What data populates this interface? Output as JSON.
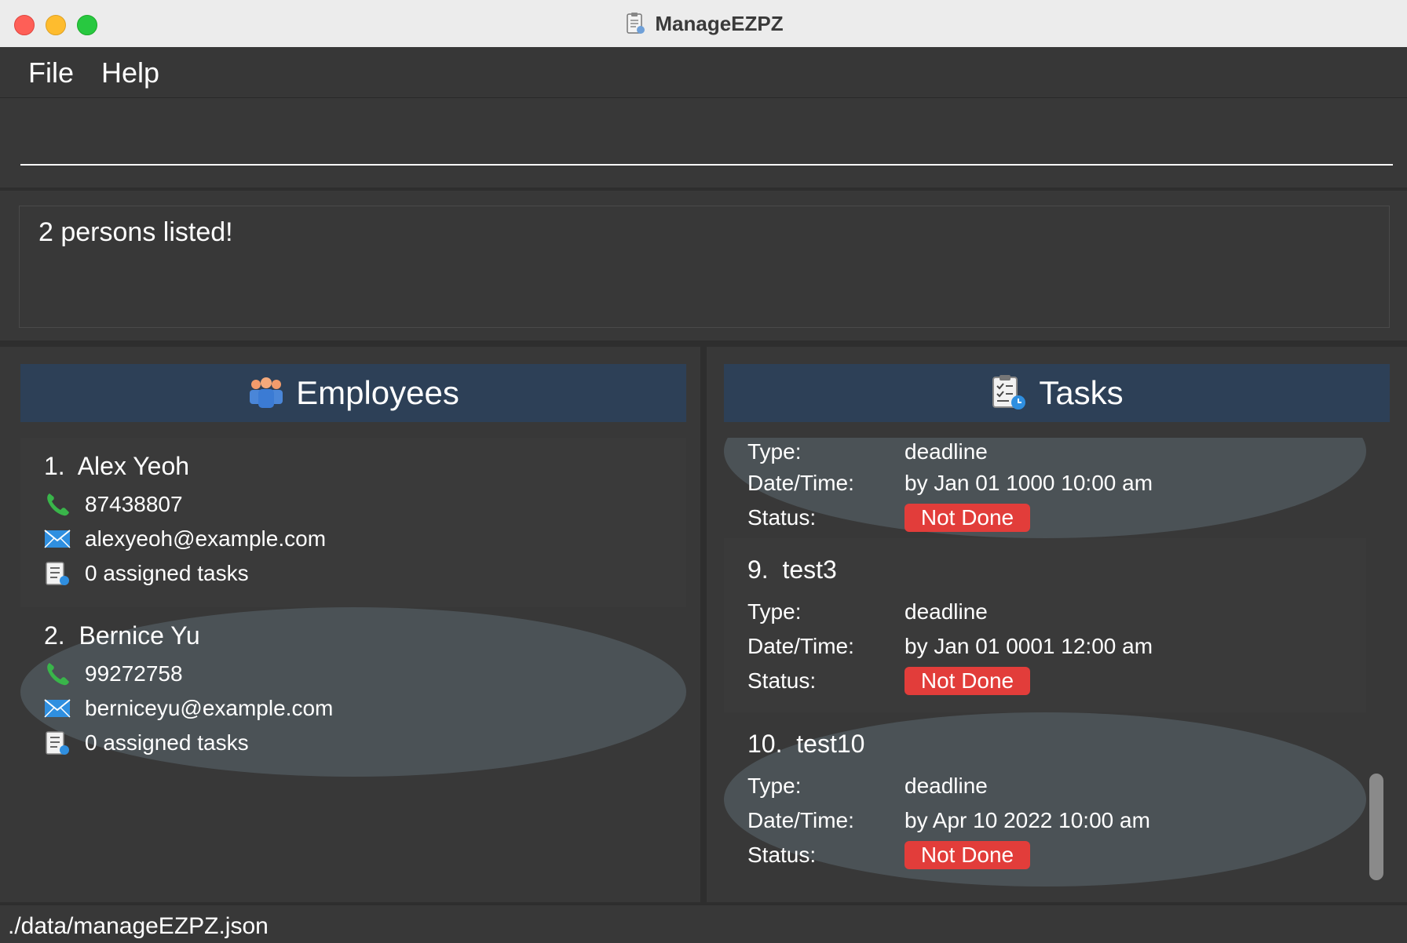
{
  "window": {
    "title": "ManageEZPZ"
  },
  "menu": [
    {
      "label": "File"
    },
    {
      "label": "Help"
    }
  ],
  "command": {
    "value": ""
  },
  "result": {
    "text": "2 persons listed!"
  },
  "employees": {
    "title": "Employees",
    "items": [
      {
        "index": "1.",
        "name": "Alex Yeoh",
        "phone": "87438807",
        "email": "alexyeoh@example.com",
        "tasks": "0 assigned tasks"
      },
      {
        "index": "2.",
        "name": "Bernice Yu",
        "phone": "99272758",
        "email": "berniceyu@example.com",
        "tasks": "0 assigned tasks"
      }
    ]
  },
  "tasks": {
    "title": "Tasks",
    "labels": {
      "type": "Type:",
      "datetime": "Date/Time:",
      "status": "Status:"
    },
    "items": [
      {
        "index": "",
        "name": "",
        "type": "deadline",
        "datetime": "by Jan 01 1000 10:00 am",
        "status": "Not Done"
      },
      {
        "index": "9.",
        "name": "test3",
        "type": "deadline",
        "datetime": "by Jan 01 0001 12:00 am",
        "status": "Not Done"
      },
      {
        "index": "10.",
        "name": "test10",
        "type": "deadline",
        "datetime": "by Apr 10 2022 10:00 am",
        "status": "Not Done"
      }
    ]
  },
  "status": {
    "path": "./data/manageEZPZ.json"
  },
  "colors": {
    "header": "#2d4057",
    "badge": "#e23d3a",
    "background": "#383838"
  }
}
